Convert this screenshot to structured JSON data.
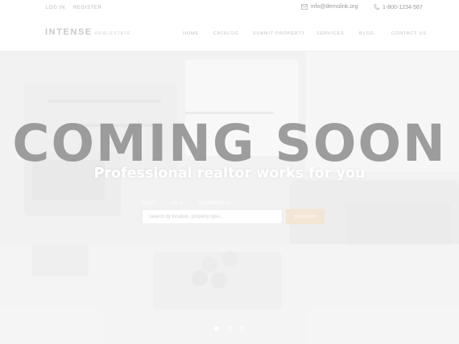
{
  "topbar": {
    "login_label": "LOG IN",
    "register_label": "REGISTER",
    "email": "info@demolink.org",
    "phone": "1-800-1234-567"
  },
  "header": {
    "logo_text": "INTENSE",
    "logo_subtext": "realestate",
    "nav": [
      "HOME",
      "CATALOG",
      "SUBMIT PROPERTY",
      "SERVICES",
      "BLOG",
      "CONTACT US"
    ]
  },
  "hero": {
    "headline": "COMING SOON",
    "subheadline": "Professional realtor works for you",
    "tabs": [
      "Rent",
      "Sale",
      "Commercial"
    ],
    "search_placeholder": "Search by location, property type...",
    "search_button": "SEARCH",
    "slider": {
      "count": 3,
      "active_index": 0
    }
  },
  "icons": {
    "email": "envelope-icon",
    "phone": "phone-icon"
  },
  "colors": {
    "accent": "#f3e6d4",
    "headline": "#8e8e8e",
    "subheadline": "#ffffff"
  }
}
